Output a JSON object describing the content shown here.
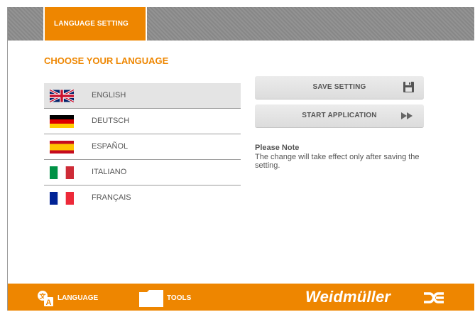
{
  "header": {
    "active_tab": "LANGUAGE SETTING"
  },
  "main": {
    "heading": "CHOOSE YOUR LANGUAGE",
    "languages": [
      {
        "label": "ENGLISH",
        "flag": "uk-flag-icon",
        "selected": true
      },
      {
        "label": "DEUTSCH",
        "flag": "germany-flag-icon"
      },
      {
        "label": "ESPAÑOL",
        "flag": "spain-flag-icon"
      },
      {
        "label": "ITALIANO",
        "flag": "italy-flag-icon"
      },
      {
        "label": "FRANÇAIS",
        "flag": "france-flag-icon"
      }
    ],
    "save_button": {
      "label": "SAVE SETTING",
      "icon": "floppy-disk-icon"
    },
    "start_button": {
      "label": "START APPLICATION",
      "icon": "fast-forward-icon"
    },
    "note": {
      "title": "Please Note",
      "text": "The change will take effect only after saving the setting."
    }
  },
  "footer": {
    "nav": [
      {
        "label": "LANGUAGE",
        "icon": "language-icon"
      },
      {
        "label": "TOOLS",
        "icon": "folder-icon"
      }
    ],
    "brand": "Weidmüller",
    "brand_logo": "weidmuller-logo-icon"
  },
  "colors": {
    "accent": "#ee8600",
    "topbar": "#8c8c8c",
    "selected_row": "#e4e4e4",
    "text": "#555555"
  }
}
